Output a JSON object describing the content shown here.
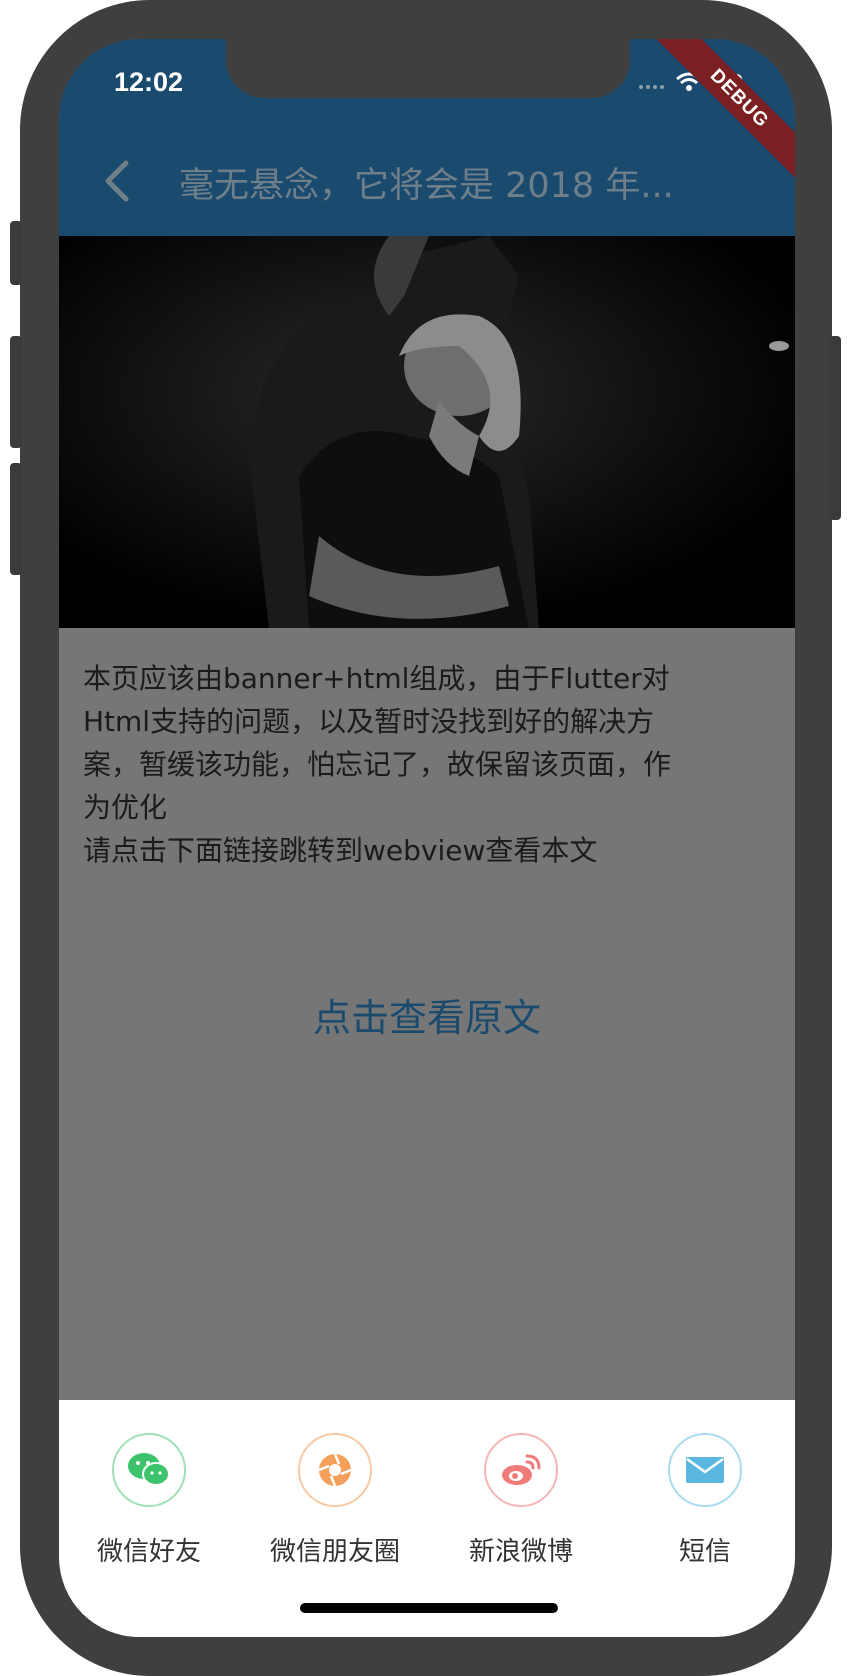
{
  "status_bar": {
    "time": "12:02",
    "debug_badge": "DEBUG"
  },
  "app_bar": {
    "title": "毫无悬念，它将会是 2018 年..."
  },
  "content": {
    "paragraph_lines": [
      "本页应该由banner+html组成，由于Flutter对",
      "Html支持的问题，以及暂时没找到好的解决方",
      "案，暂缓该功能，怕忘记了，故保留该页面，作",
      "为优化",
      "请点击下面链接跳转到webview查看本文"
    ],
    "link_text": "点击查看原文"
  },
  "share_sheet": {
    "items": [
      {
        "label": "微信好友",
        "icon": "wechat-icon",
        "color": "#3dc36b"
      },
      {
        "label": "微信朋友圈",
        "icon": "moments-icon",
        "color": "#f5a05a"
      },
      {
        "label": "新浪微博",
        "icon": "weibo-icon",
        "color": "#f07b7b"
      },
      {
        "label": "短信",
        "icon": "sms-icon",
        "color": "#5ab8e0"
      }
    ]
  },
  "colors": {
    "app_bar": "#1a4a6e",
    "overlay": "#767676",
    "link": "#1a4a6e"
  }
}
